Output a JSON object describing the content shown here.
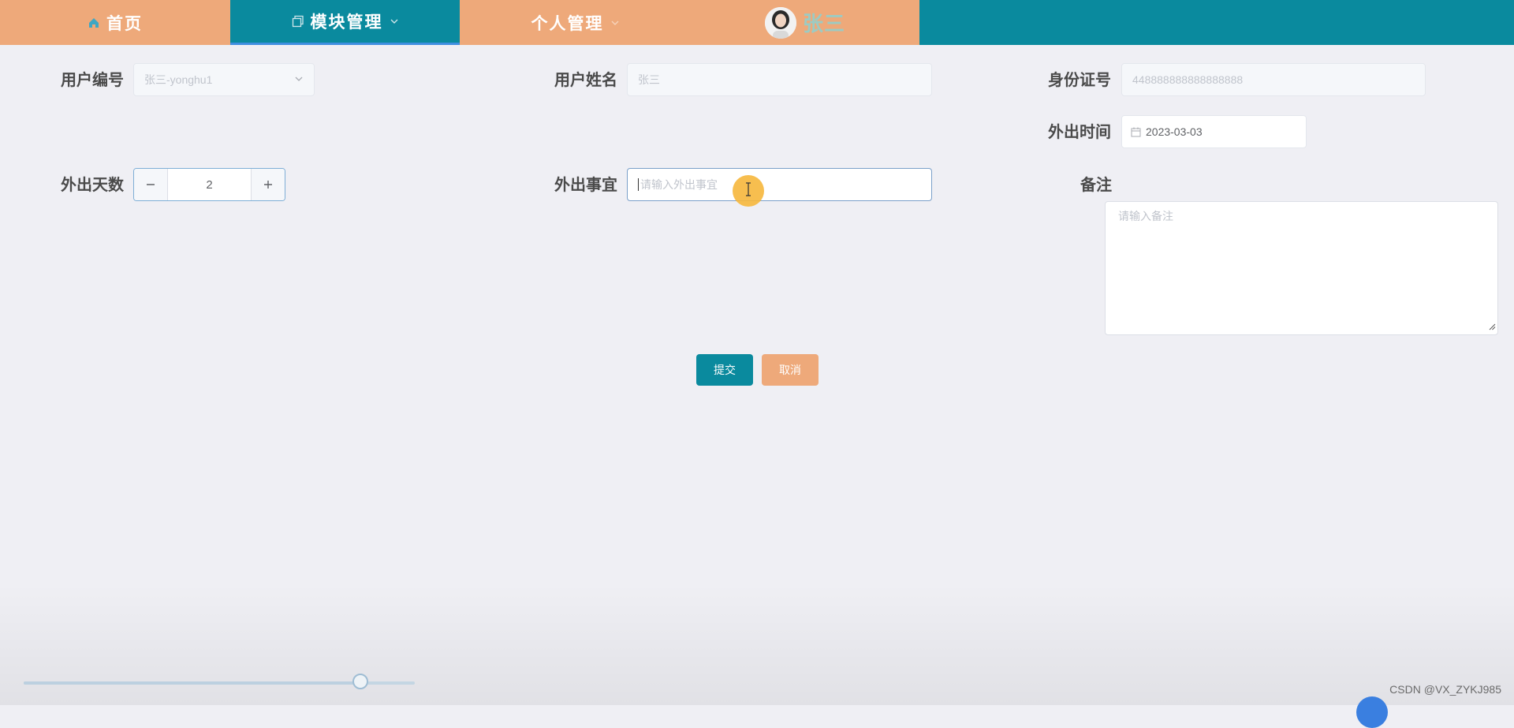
{
  "nav": {
    "home": "首页",
    "module": "模块管理",
    "personal": "个人管理",
    "user_name": "张三"
  },
  "form": {
    "user_id": {
      "label": "用户编号",
      "value": "张三-yonghu1"
    },
    "user_name": {
      "label": "用户姓名",
      "value": "张三"
    },
    "id_card": {
      "label": "身份证号",
      "value": "448888888888888888"
    },
    "out_time": {
      "label": "外出时间",
      "value": "2023-03-03"
    },
    "out_days": {
      "label": "外出天数",
      "value": "2"
    },
    "out_matter": {
      "label": "外出事宜",
      "placeholder": "请输入外出事宜"
    },
    "remark": {
      "label": "备注",
      "placeholder": "请输入备注"
    }
  },
  "buttons": {
    "submit": "提交",
    "cancel": "取消"
  },
  "progress": {
    "fraction": 0.86
  },
  "watermark": "CSDN @VX_ZYKJ985",
  "colors": {
    "teal": "#0a8a9e",
    "orange": "#eea97a"
  },
  "icons": [
    "home-icon",
    "module-icon",
    "chevron-down-icon",
    "calendar-icon",
    "select-arrow-icon",
    "minus-icon",
    "plus-icon",
    "text-cursor-icon",
    "resize-grip-icon"
  ]
}
